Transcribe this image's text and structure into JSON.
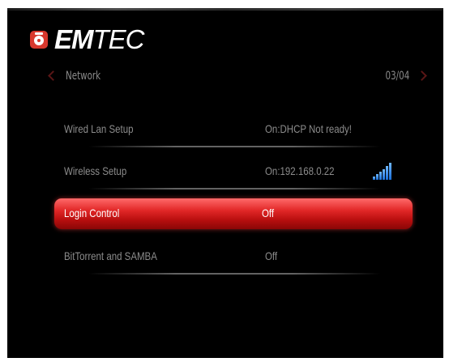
{
  "brand": {
    "name_bold": "EM",
    "name_light": "TEC",
    "logo_icon": "emtec-logo-icon",
    "accent_color": "#d8382d"
  },
  "header": {
    "title": "Network",
    "page_indicator": "03/04",
    "prev_icon": "chevron-left-icon",
    "next_icon": "chevron-right-icon"
  },
  "menu": {
    "items": [
      {
        "label": "Wired Lan Setup",
        "value": "On:DHCP Not ready!",
        "selected": false
      },
      {
        "label": "Wireless Setup",
        "value": "On:192.168.0.22",
        "selected": false,
        "status_icon": "wifi-signal-icon"
      },
      {
        "label": "Login Control",
        "value": "Off",
        "selected": true
      },
      {
        "label": "BitTorrent and SAMBA",
        "value": "Off",
        "selected": false
      }
    ],
    "highlight_color": "#e02626"
  }
}
